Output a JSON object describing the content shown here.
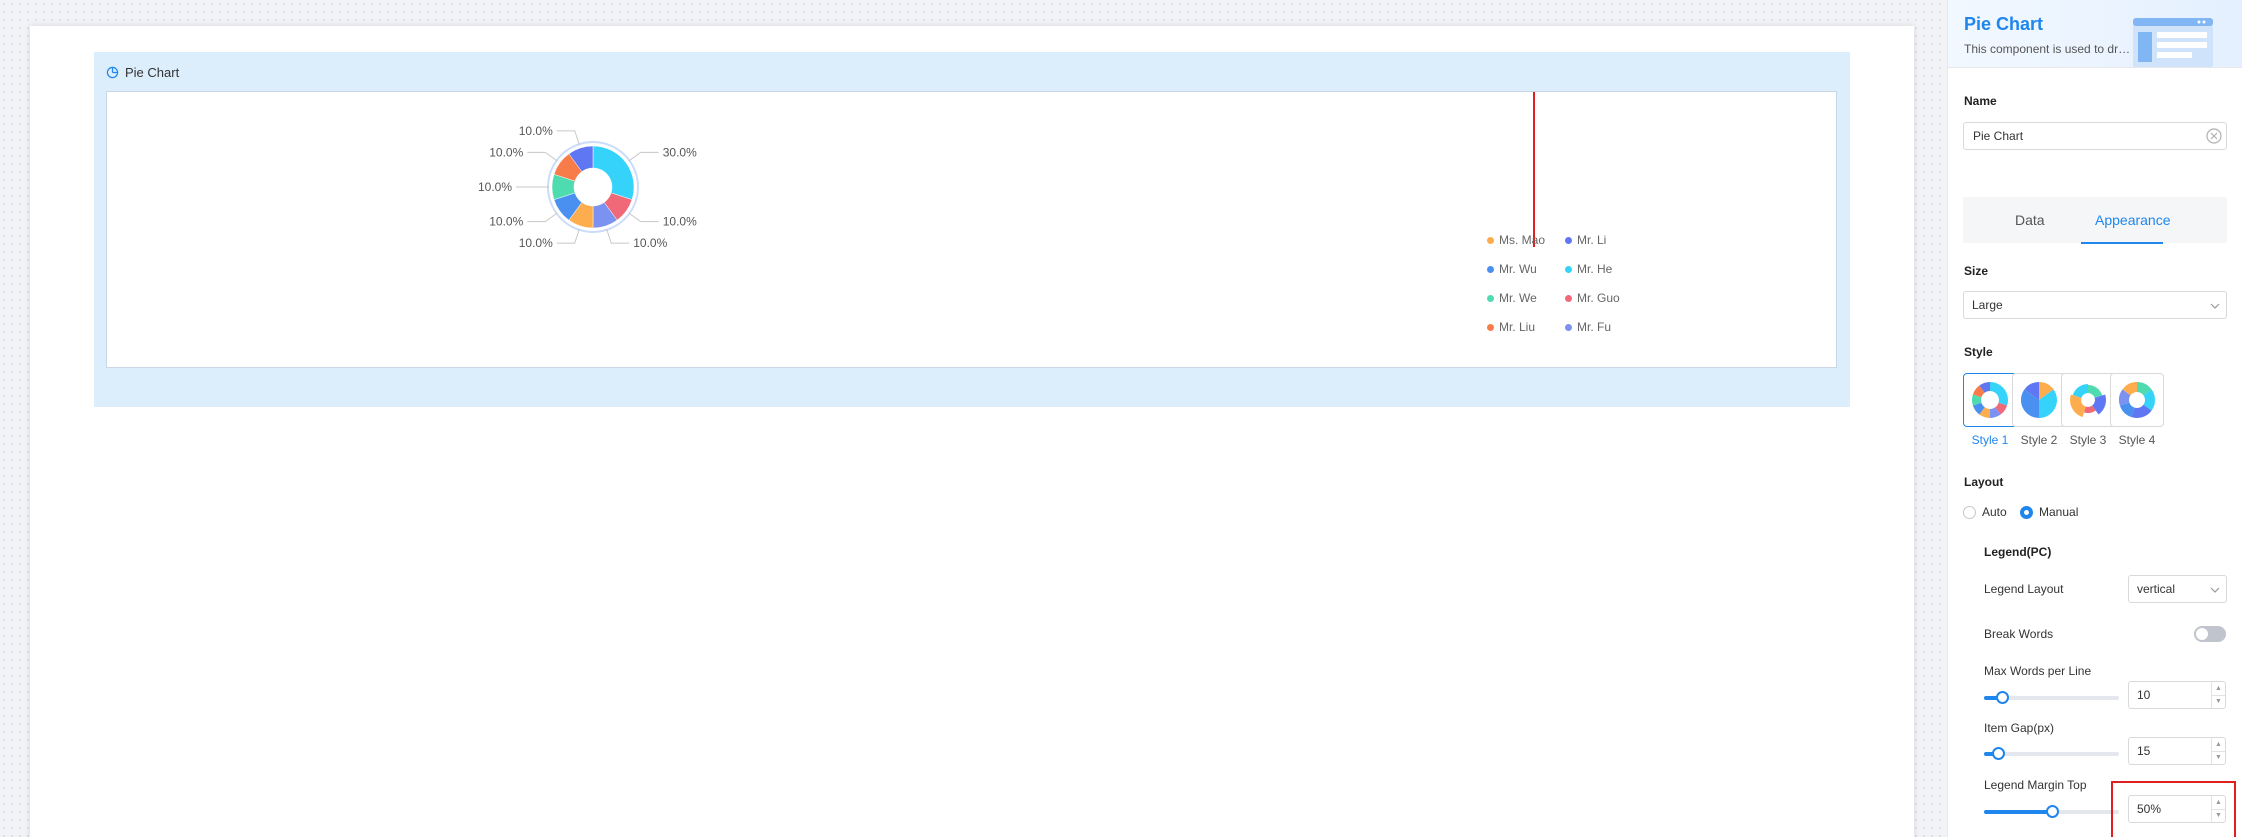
{
  "widget": {
    "title": "Pie Chart",
    "icon": "pie-chart-icon"
  },
  "chart_data": {
    "type": "pie",
    "style": "donut",
    "categories": [
      "Ms. Mao",
      "Mr. Li",
      "Mr. Wu",
      "Mr. He",
      "Mr. We",
      "Mr. Guo",
      "Mr. Liu",
      "Mr. Fu"
    ],
    "values": [
      10,
      10,
      10,
      30,
      10,
      10,
      10,
      10
    ],
    "slice_labels": [
      "10.0%",
      "10.0%",
      "10.0%",
      "30.0%",
      "10.0%",
      "10.0%",
      "10.0%",
      "10.0%"
    ],
    "colors": [
      "#fdac4e",
      "#6077f4",
      "#4a90f0",
      "#35d3fa",
      "#4fdbb0",
      "#f06978",
      "#f77c4a",
      "#7b92f0"
    ],
    "legend_position": "right",
    "legend_layout": "vertical"
  },
  "legend_items": [
    {
      "label": "Ms. Mao",
      "color": "#fdac4e"
    },
    {
      "label": "Mr. Li",
      "color": "#6077f4"
    },
    {
      "label": "Mr. Wu",
      "color": "#4a90f0"
    },
    {
      "label": "Mr. He",
      "color": "#35d3fa"
    },
    {
      "label": "Mr. We",
      "color": "#4fdbb0"
    },
    {
      "label": "Mr. Guo",
      "color": "#f06978"
    },
    {
      "label": "Mr. Liu",
      "color": "#f77c4a"
    },
    {
      "label": "Mr. Fu",
      "color": "#7b92f0"
    }
  ],
  "panel": {
    "title": "Pie Chart",
    "description": "This component is used to draw pie charts",
    "name_label": "Name",
    "name_value": "Pie Chart",
    "tabs": [
      {
        "label": "Data",
        "active": false
      },
      {
        "label": "Appearance",
        "active": true
      }
    ],
    "size": {
      "label": "Size",
      "value": "Large"
    },
    "style": {
      "label": "Style",
      "options": [
        "Style 1",
        "Style 2",
        "Style 3",
        "Style 4"
      ],
      "selected": "Style 1"
    },
    "layout": {
      "label": "Layout",
      "options": [
        "Auto",
        "Manual"
      ],
      "selected": "Manual"
    },
    "legend_pc": {
      "heading": "Legend(PC)",
      "legend_layout_label": "Legend Layout",
      "legend_layout_value": "vertical",
      "break_words_label": "Break Words",
      "break_words_on": false,
      "max_words_label": "Max Words per Line",
      "max_words_value": "10",
      "max_words_fraction": 0.13,
      "item_gap_label": "Item Gap(px)",
      "item_gap_value": "15",
      "item_gap_fraction": 0.1,
      "margin_top_label": "Legend Margin Top",
      "margin_top_value": "50%",
      "margin_top_fraction": 0.5
    }
  }
}
